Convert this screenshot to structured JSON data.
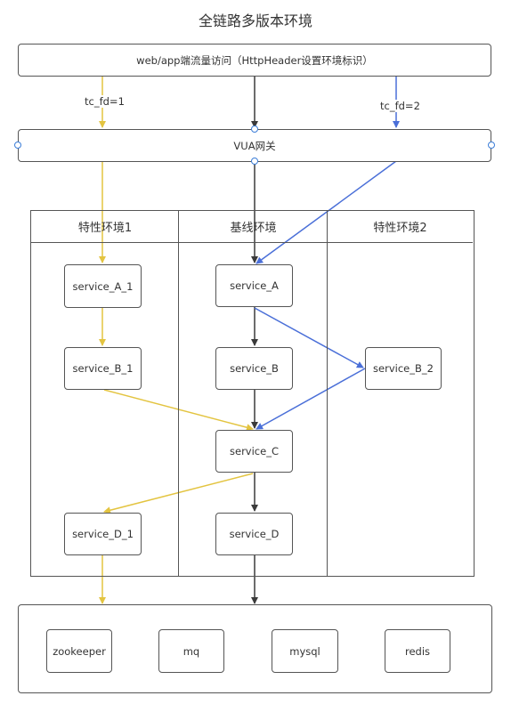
{
  "title": "全链路多版本环境",
  "client": {
    "label": "web/app端流量访问（HttpHeader设置环境标识）"
  },
  "gateway": {
    "label": "VUA网关"
  },
  "edge_labels": {
    "feature1_route": "tc_fd=1",
    "feature2_route": "tc_fd=2"
  },
  "lanes": [
    {
      "label": "特性环境1"
    },
    {
      "label": "基线环境"
    },
    {
      "label": "特性环境2"
    }
  ],
  "services": {
    "service_A_1": "service_A_1",
    "service_B_1": "service_B_1",
    "service_D_1": "service_D_1",
    "service_A": "service_A",
    "service_B": "service_B",
    "service_C": "service_C",
    "service_D": "service_D",
    "service_B_2": "service_B_2"
  },
  "infrastructure": [
    {
      "label": "zookeeper"
    },
    {
      "label": "mq"
    },
    {
      "label": "mysql"
    },
    {
      "label": "redis"
    }
  ],
  "colors": {
    "baseline": "#3a3a3a",
    "feature1": "#e3c440",
    "feature2": "#4a6fd8",
    "border": "#555555",
    "port": "#3b7dd8"
  }
}
